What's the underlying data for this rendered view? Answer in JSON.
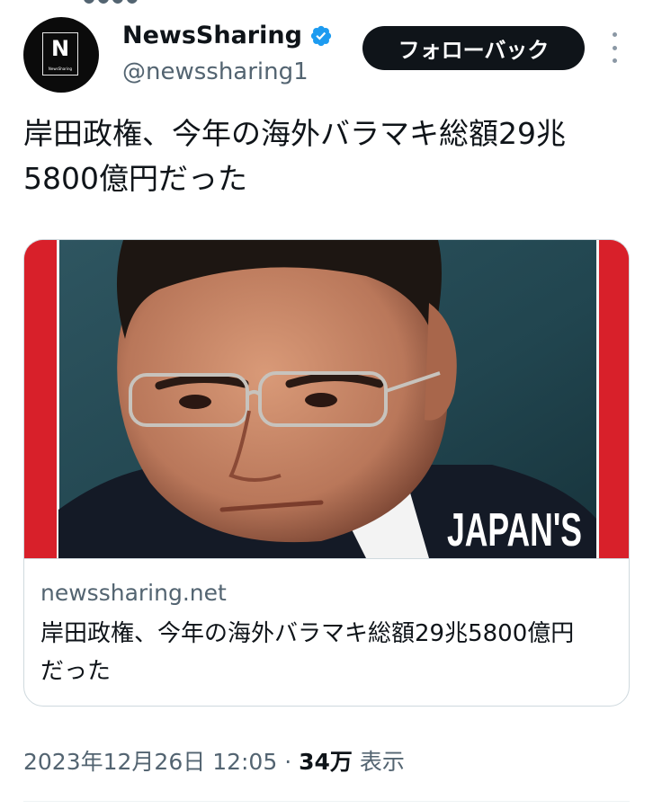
{
  "author": {
    "avatar_letter": "N",
    "avatar_caption": "NewsSharing",
    "display_name": "NewsSharing",
    "handle": "@newssharing1",
    "verified": true
  },
  "follow_button_label": "フォローバック",
  "tweet_text": "岸田政権、今年の海外バラマキ総額29兆5800億円だった",
  "card": {
    "image_overlay_text": "JAPAN'S",
    "domain": "newssharing.net",
    "title": "岸田政権、今年の海外バラマキ総額29兆5800億円だった"
  },
  "meta": {
    "timestamp": "2023年12月26日 12:05",
    "separator": "·",
    "views_count": "34万",
    "views_label": "表示"
  },
  "colors": {
    "verified_blue": "#1d9bf0",
    "text_primary": "#0f1419",
    "text_secondary": "#536471",
    "card_frame_red": "#d8202a"
  },
  "icons": {
    "verified": "verified-badge-icon",
    "more": "more-vertical-icon"
  }
}
